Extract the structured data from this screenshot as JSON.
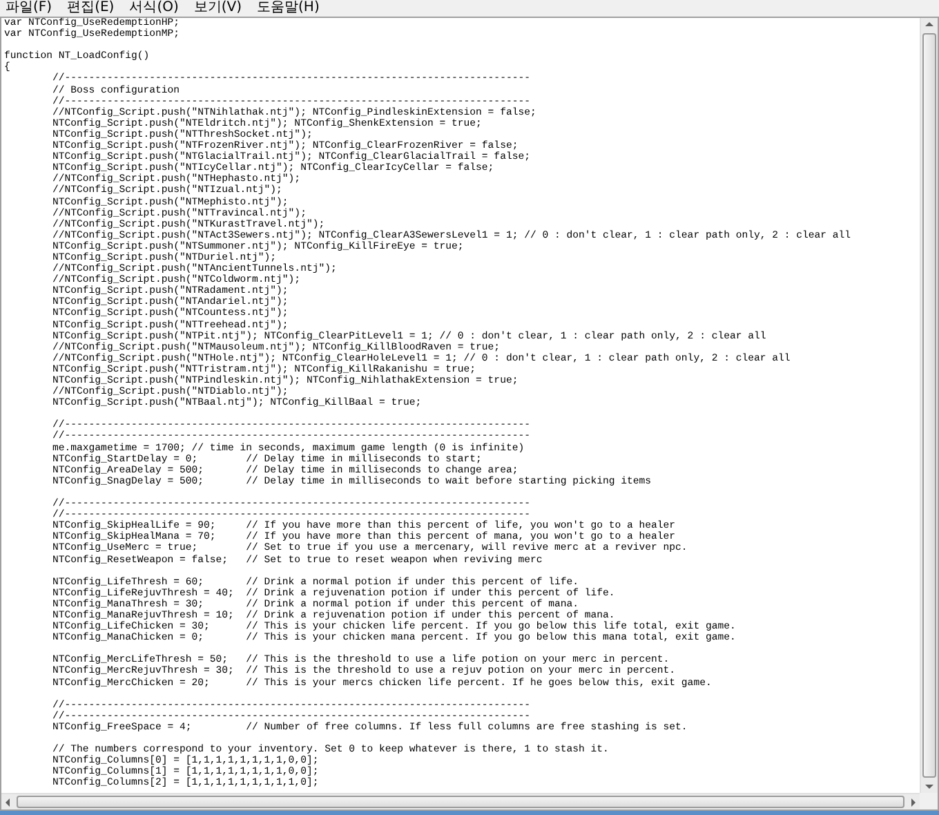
{
  "menu": [
    "파일(F)",
    "편집(E)",
    "서식(O)",
    "보기(V)",
    "도움말(H)"
  ],
  "blocks": [
    [
      "var NTConfig_UseRedemptionHP;",
      "var NTConfig_UseRedemptionMP;"
    ],
    [
      "function NT_LoadConfig()",
      "{",
      "\t//-----------------------------------------------------------------------------",
      "\t// Boss configuration",
      "\t//-----------------------------------------------------------------------------",
      "\t//NTConfig_Script.push(\"NTNihlathak.ntj\"); NTConfig_PindleskinExtension = false;",
      "\tNTConfig_Script.push(\"NTEldritch.ntj\"); NTConfig_ShenkExtension = true;",
      "\tNTConfig_Script.push(\"NTThreshSocket.ntj\");",
      "\tNTConfig_Script.push(\"NTFrozenRiver.ntj\"); NTConfig_ClearFrozenRiver = false;",
      "\tNTConfig_Script.push(\"NTGlacialTrail.ntj\"); NTConfig_ClearGlacialTrail = false;",
      "\tNTConfig_Script.push(\"NTIcyCellar.ntj\"); NTConfig_ClearIcyCellar = false;",
      "\t//NTConfig_Script.push(\"NTHephasto.ntj\");",
      "\t//NTConfig_Script.push(\"NTIzual.ntj\");",
      "\tNTConfig_Script.push(\"NTMephisto.ntj\");",
      "\t//NTConfig_Script.push(\"NTTravincal.ntj\");",
      "\t//NTConfig_Script.push(\"NTKurastTravel.ntj\");",
      "\t//NTConfig_Script.push(\"NTAct3Sewers.ntj\"); NTConfig_ClearA3SewersLevel1 = 1; // 0 : don't clear, 1 : clear path only, 2 : clear all",
      "\tNTConfig_Script.push(\"NTSummoner.ntj\"); NTConfig_KillFireEye = true;",
      "\tNTConfig_Script.push(\"NTDuriel.ntj\");",
      "\t//NTConfig_Script.push(\"NTAncientTunnels.ntj\");",
      "\t//NTConfig_Script.push(\"NTColdworm.ntj\");",
      "\tNTConfig_Script.push(\"NTRadament.ntj\");",
      "\tNTConfig_Script.push(\"NTAndariel.ntj\");",
      "\tNTConfig_Script.push(\"NTCountess.ntj\");",
      "\tNTConfig_Script.push(\"NTTreehead.ntj\");",
      "\tNTConfig_Script.push(\"NTPit.ntj\"); NTConfig_ClearPitLevel1 = 1; // 0 : don't clear, 1 : clear path only, 2 : clear all",
      "\t//NTConfig_Script.push(\"NTMausoleum.ntj\"); NTConfig_KillBloodRaven = true;",
      "\t//NTConfig_Script.push(\"NTHole.ntj\"); NTConfig_ClearHoleLevel1 = 1; // 0 : don't clear, 1 : clear path only, 2 : clear all",
      "\tNTConfig_Script.push(\"NTTristram.ntj\"); NTConfig_KillRakanishu = true;",
      "\tNTConfig_Script.push(\"NTPindleskin.ntj\"); NTConfig_NihlathakExtension = true;",
      "\t//NTConfig_Script.push(\"NTDiablo.ntj\");",
      "\tNTConfig_Script.push(\"NTBaal.ntj\"); NTConfig_KillBaal = true;"
    ],
    [
      "\t//-----------------------------------------------------------------------------",
      "\t//-----------------------------------------------------------------------------",
      "\tme.maxgametime = 1700; // time in seconds, maximum game length (0 is infinite)",
      "\tNTConfig_StartDelay = 0;\t// Delay time in milliseconds to start;",
      "\tNTConfig_AreaDelay = 500;\t// Delay time in milliseconds to change area;",
      "\tNTConfig_SnagDelay = 500;\t// Delay time in milliseconds to wait before starting picking items"
    ],
    [
      "\t//-----------------------------------------------------------------------------",
      "\t//-----------------------------------------------------------------------------",
      "\tNTConfig_SkipHealLife = 90;\t// If you have more than this percent of life, you won't go to a healer",
      "\tNTConfig_SkipHealMana = 70;\t// If you have more than this percent of mana, you won't go to a healer",
      "\tNTConfig_UseMerc = true;\t// Set to true if you use a mercenary, will revive merc at a reviver npc.",
      "\tNTConfig_ResetWeapon = false;\t// Set to true to reset weapon when reviving merc"
    ],
    [
      "\tNTConfig_LifeThresh = 60;\t// Drink a normal potion if under this percent of life.",
      "\tNTConfig_LifeRejuvThresh = 40;\t// Drink a rejuvenation potion if under this percent of life.",
      "\tNTConfig_ManaThresh = 30;\t// Drink a normal potion if under this percent of mana.",
      "\tNTConfig_ManaRejuvThresh = 10;\t// Drink a rejuvenation potion if under this percent of mana.",
      "\tNTConfig_LifeChicken = 30;\t// This is your chicken life percent. If you go below this life total, exit game.",
      "\tNTConfig_ManaChicken = 0;\t// This is your chicken mana percent. If you go below this mana total, exit game."
    ],
    [
      "\tNTConfig_MercLifeThresh = 50;\t// This is the threshold to use a life potion on your merc in percent.",
      "\tNTConfig_MercRejuvThresh = 30;\t// This is the threshold to use a rejuv potion on your merc in percent.",
      "\tNTConfig_MercChicken = 20;\t// This is your mercs chicken life percent. If he goes below this, exit game."
    ],
    [
      "\t//-----------------------------------------------------------------------------",
      "\t//-----------------------------------------------------------------------------",
      "\tNTConfig_FreeSpace = 4;\t\t// Number of free columns. If less full columns are free stashing is set."
    ],
    [
      "\t// The numbers correspond to your inventory. Set 0 to keep whatever is there, 1 to stash it.",
      "\tNTConfig_Columns[0] = [1,1,1,1,1,1,1,1,0,0];",
      "\tNTConfig_Columns[1] = [1,1,1,1,1,1,1,1,0,0];",
      "\tNTConfig_Columns[2] = [1,1,1,1,1,1,1,1,1,0];"
    ]
  ]
}
